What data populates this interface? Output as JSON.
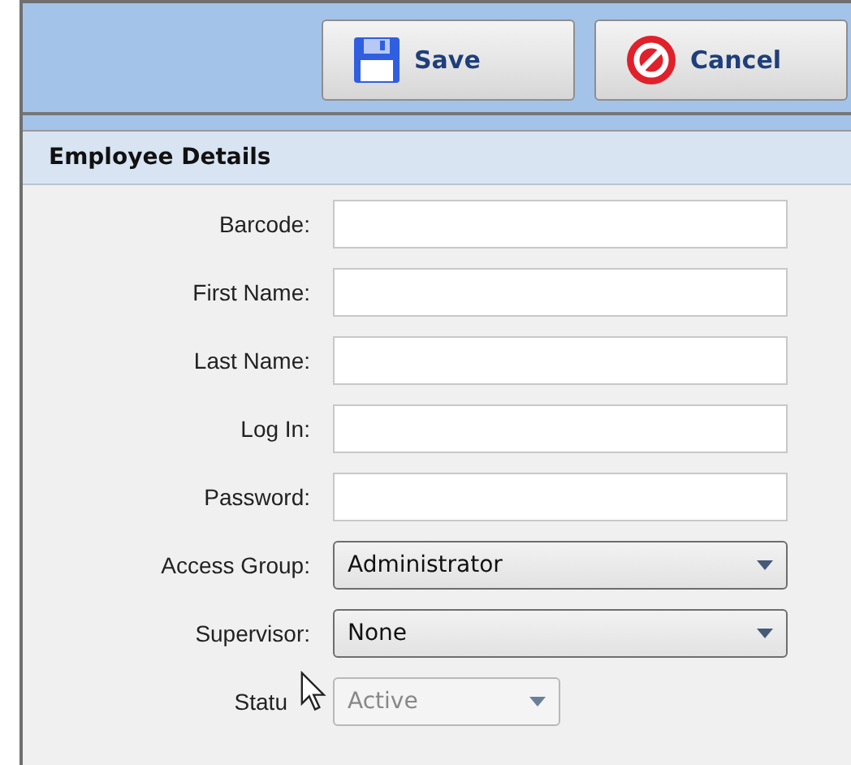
{
  "toolbar": {
    "buttons": [
      {
        "kind": "save",
        "label": "Save"
      },
      {
        "kind": "cancel",
        "label": "Cancel"
      }
    ]
  },
  "panel": {
    "title": "Employee Details",
    "fields": [
      {
        "kind": "text",
        "label": "Barcode:"
      },
      {
        "kind": "text",
        "label": "First Name:"
      },
      {
        "kind": "text",
        "label": "Last Name:"
      },
      {
        "kind": "text",
        "label": "Log In:"
      },
      {
        "kind": "text",
        "label": "Password:"
      },
      {
        "kind": "combo",
        "label": "Access Group:",
        "value": "Administrator",
        "disabled": false
      },
      {
        "kind": "combo",
        "label": "Supervisor:",
        "value": "None",
        "disabled": false
      },
      {
        "kind": "combo",
        "label": "Statu",
        "value": "Active",
        "disabled": true,
        "short": true
      }
    ]
  }
}
